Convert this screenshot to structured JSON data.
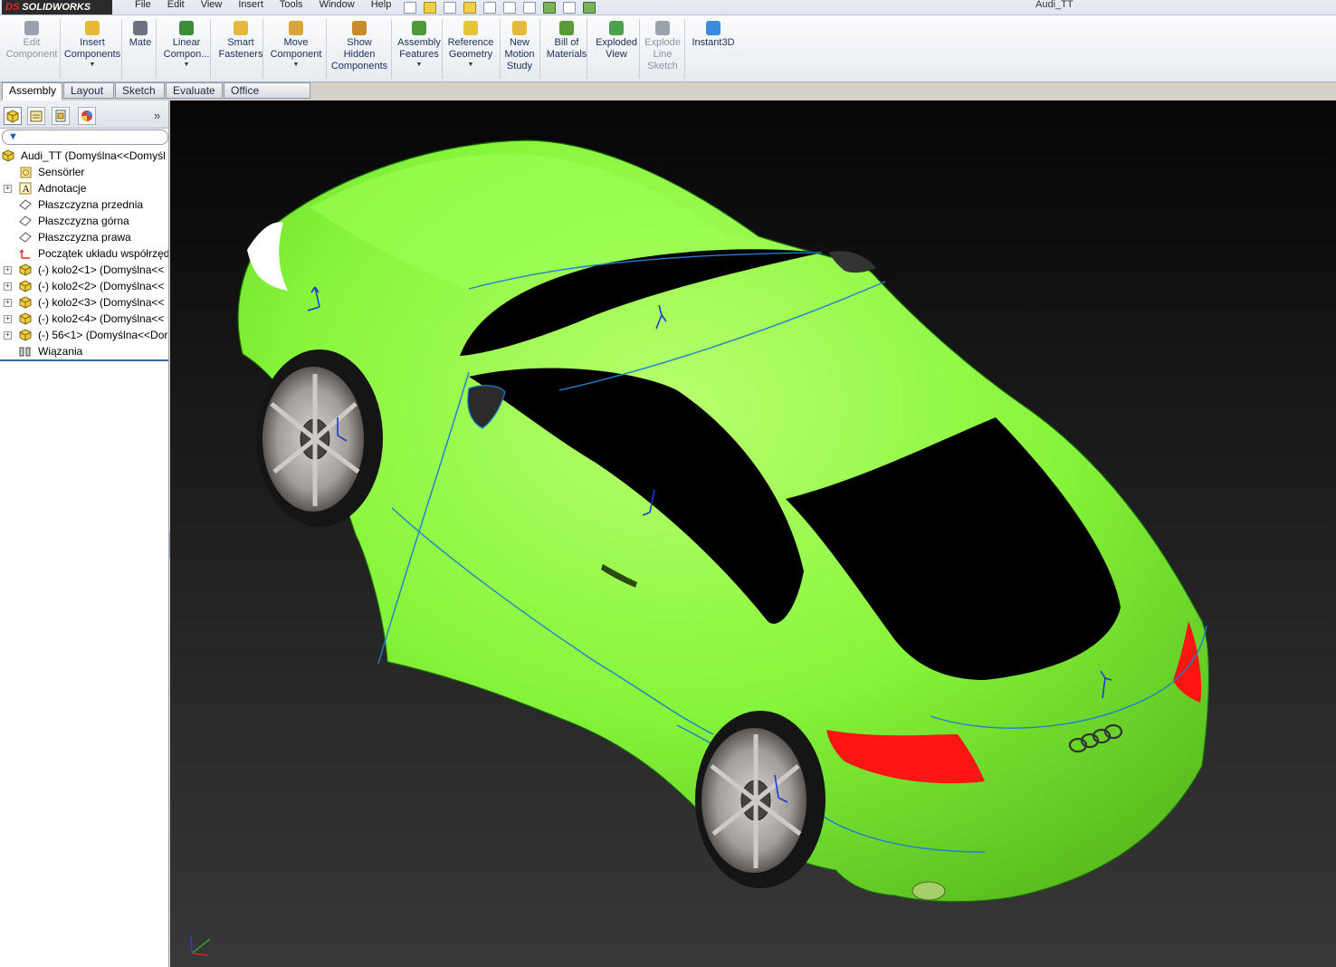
{
  "app": {
    "logo": "SOLIDWORKS",
    "logo_prefix": "DS",
    "document_title": "Audi_TT"
  },
  "menubar": [
    "File",
    "Edit",
    "View",
    "Insert",
    "Tools",
    "Window",
    "Help"
  ],
  "ribbon": {
    "buttons": [
      {
        "label": "Edit\nComponent",
        "icon": "edit-component-icon",
        "enabled": false
      },
      {
        "label": "Insert\nComponents",
        "icon": "insert-components-icon",
        "enabled": true,
        "dropdown": true
      },
      {
        "label": "Mate",
        "icon": "mate-icon",
        "enabled": true
      },
      {
        "label": "Linear\nCompon...",
        "icon": "linear-pattern-icon",
        "enabled": true,
        "dropdown": true
      },
      {
        "label": "Smart\nFasteners",
        "icon": "smart-fasteners-icon",
        "enabled": true
      },
      {
        "label": "Move\nComponent",
        "icon": "move-component-icon",
        "enabled": true,
        "dropdown": true
      },
      {
        "label": "Show\nHidden\nComponents",
        "icon": "show-hidden-icon",
        "enabled": true
      },
      {
        "label": "Assembly\nFeatures",
        "icon": "assembly-features-icon",
        "enabled": true,
        "dropdown": true
      },
      {
        "label": "Reference\nGeometry",
        "icon": "reference-geometry-icon",
        "enabled": true,
        "dropdown": true
      },
      {
        "label": "New\nMotion\nStudy",
        "icon": "motion-study-icon",
        "enabled": true
      },
      {
        "label": "Bill of\nMaterials",
        "icon": "bill-of-materials-icon",
        "enabled": true
      },
      {
        "label": "Exploded\nView",
        "icon": "exploded-view-icon",
        "enabled": true
      },
      {
        "label": "Explode\nLine\nSketch",
        "icon": "explode-line-icon",
        "enabled": false
      },
      {
        "label": "Instant3D",
        "icon": "instant3d-icon",
        "enabled": true
      }
    ]
  },
  "command_tabs": [
    "Assembly",
    "Layout",
    "Sketch",
    "Evaluate",
    "Office Products"
  ],
  "active_tab": "Assembly",
  "feature_tree": {
    "root": "Audi_TT  (Domyślna<<Domyśl",
    "items": [
      {
        "label": "Sensörler",
        "icon": "sensor-icon",
        "expandable": false
      },
      {
        "label": "Adnotacje",
        "icon": "annotation-icon",
        "expandable": true
      },
      {
        "label": "Płaszczyzna przednia",
        "icon": "plane-icon",
        "expandable": false
      },
      {
        "label": "Płaszczyzna górna",
        "icon": "plane-icon",
        "expandable": false
      },
      {
        "label": "Płaszczyzna prawa",
        "icon": "plane-icon",
        "expandable": false
      },
      {
        "label": "Początek układu współrzędn",
        "icon": "origin-icon",
        "expandable": false
      },
      {
        "label": "(-) kolo2<1> (Domyślna<<",
        "icon": "part-icon",
        "expandable": true
      },
      {
        "label": "(-) kolo2<2> (Domyślna<<",
        "icon": "part-icon",
        "expandable": true
      },
      {
        "label": "(-) kolo2<3> (Domyślna<<",
        "icon": "part-icon",
        "expandable": true
      },
      {
        "label": "(-) kolo2<4> (Domyślna<<",
        "icon": "part-icon",
        "expandable": true
      },
      {
        "label": "(-) 56<1> (Domyślna<<Dor",
        "icon": "part-icon",
        "expandable": true
      },
      {
        "label": "Wiązania",
        "icon": "mates-folder-icon",
        "expandable": false
      }
    ]
  },
  "colors": {
    "body": "#86f53a",
    "glass": "#000000",
    "taillight": "#ff1414",
    "edge": "#1e7fd0",
    "wheel": "#9a9592"
  }
}
